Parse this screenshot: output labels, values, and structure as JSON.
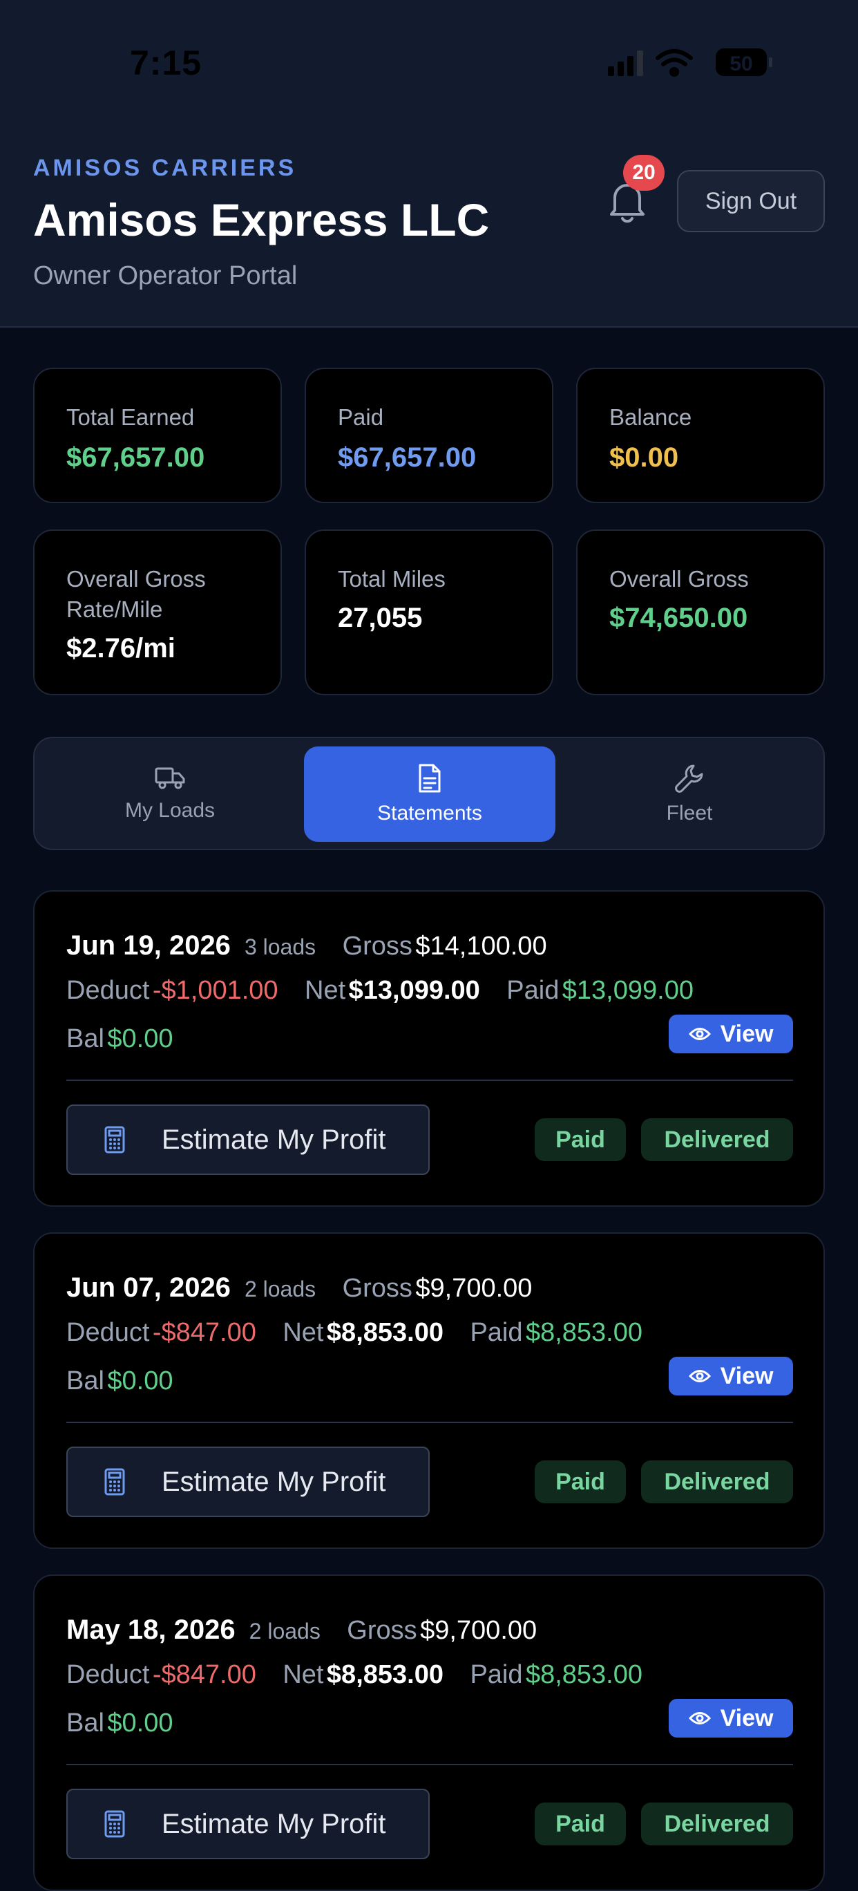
{
  "status_bar": {
    "time": "7:15",
    "battery": "50"
  },
  "header": {
    "brand": "AMISOS CARRIERS",
    "company": "Amisos Express LLC",
    "subtitle": "Owner Operator Portal",
    "notification_count": "20",
    "sign_out_label": "Sign Out"
  },
  "stats": [
    {
      "label": "Total Earned",
      "value": "$67,657.00",
      "color": "#5fcf8b"
    },
    {
      "label": "Paid",
      "value": "$67,657.00",
      "color": "#6f9bf0"
    },
    {
      "label": "Balance",
      "value": "$0.00",
      "color": "#f0c04e"
    },
    {
      "label": "Overall Gross Rate/Mile",
      "value": "$2.76/mi",
      "color": "#ffffff"
    },
    {
      "label": "Total Miles",
      "value": "27,055",
      "color": "#ffffff"
    },
    {
      "label": "Overall Gross",
      "value": "$74,650.00",
      "color": "#5fcf8b"
    }
  ],
  "tabs": [
    {
      "label": "My Loads",
      "icon": "truck-icon"
    },
    {
      "label": "Statements",
      "icon": "document-icon",
      "active": true
    },
    {
      "label": "Fleet",
      "icon": "wrench-icon"
    }
  ],
  "labels": {
    "gross": "Gross",
    "deduct": "Deduct",
    "net": "Net",
    "paid": "Paid",
    "bal": "Bal",
    "view": "View",
    "estimate": "Estimate My Profit",
    "status_paid": "Paid",
    "status_delivered": "Delivered"
  },
  "statements": [
    {
      "date": "Jun 19, 2026",
      "loads": "3 loads",
      "gross": "$14,100.00",
      "deduct": "-$1,001.00",
      "net": "$13,099.00",
      "paid": "$13,099.00",
      "bal": "$0.00"
    },
    {
      "date": "Jun 07, 2026",
      "loads": "2 loads",
      "gross": "$9,700.00",
      "deduct": "-$847.00",
      "net": "$8,853.00",
      "paid": "$8,853.00",
      "bal": "$0.00"
    },
    {
      "date": "May 18, 2026",
      "loads": "2 loads",
      "gross": "$9,700.00",
      "deduct": "-$847.00",
      "net": "$8,853.00",
      "paid": "$8,853.00",
      "bal": "$0.00"
    }
  ]
}
